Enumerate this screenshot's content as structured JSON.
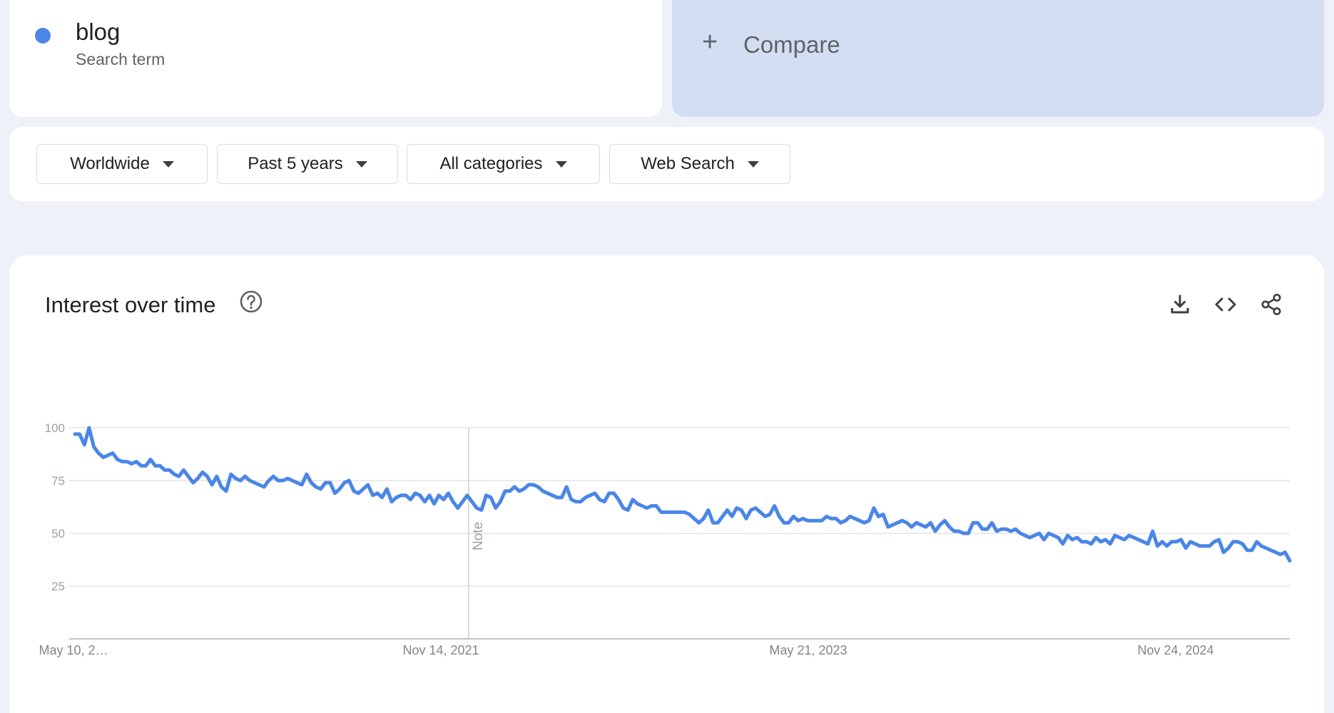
{
  "term": {
    "name": "blog",
    "type_label": "Search term",
    "color": "#4a86e8"
  },
  "compare": {
    "label": "Compare",
    "plus_glyph": "+"
  },
  "filters": [
    {
      "label": "Worldwide"
    },
    {
      "label": "Past 5 years"
    },
    {
      "label": "All categories"
    },
    {
      "label": "Web Search"
    }
  ],
  "chart_section": {
    "title": "Interest over time",
    "help_icon": "help-circle-icon",
    "toolbar_icons": [
      "download-icon",
      "embed-code-icon",
      "share-icon"
    ]
  },
  "chart_data": {
    "type": "line",
    "title": "Interest over time",
    "x_labels": [
      "May 10, 2…",
      "Nov 14, 2021",
      "May 21, 2023",
      "Nov 24, 2024"
    ],
    "y_ticks": [
      25,
      50,
      75,
      100
    ],
    "ylim": [
      0,
      100
    ],
    "grid": true,
    "annotation": {
      "label": "Note",
      "x_label": "Nov 14, 2021"
    },
    "series": [
      {
        "color": "#4a86e8",
        "values": [
          97,
          97,
          92,
          100,
          91,
          88,
          86,
          87,
          88,
          85,
          84,
          84,
          83,
          84,
          82,
          82,
          85,
          82,
          82,
          80,
          80,
          78,
          77,
          80,
          77,
          74,
          76,
          79,
          77,
          73,
          77,
          72,
          70,
          78,
          76,
          75,
          77,
          75,
          74,
          73,
          72,
          75,
          77,
          75,
          75,
          76,
          75,
          74,
          73,
          78,
          74,
          72,
          71,
          74,
          74,
          69,
          71,
          74,
          75,
          70,
          69,
          71,
          73,
          68,
          69,
          67,
          71,
          65,
          67,
          68,
          68,
          66,
          69,
          68,
          65,
          68,
          64,
          68,
          66,
          69,
          65,
          62,
          65,
          68,
          65,
          62,
          61,
          68,
          67,
          62,
          65,
          70,
          70,
          72,
          70,
          71,
          73,
          73,
          72,
          70,
          69,
          68,
          67,
          67,
          72,
          66,
          65,
          65,
          67,
          68,
          69,
          66,
          65,
          69,
          69,
          66,
          62,
          61,
          66,
          64,
          63,
          62,
          63,
          63,
          60,
          60,
          60,
          60,
          60,
          60,
          59,
          57,
          55,
          57,
          61,
          55,
          55,
          58,
          61,
          58,
          62,
          61,
          57,
          61,
          62,
          60,
          58,
          59,
          63,
          58,
          55,
          55,
          58,
          56,
          57,
          56,
          56,
          56,
          56,
          58,
          57,
          57,
          55,
          56,
          58,
          57,
          56,
          55,
          56,
          62,
          58,
          59,
          53,
          54,
          55,
          56,
          55,
          53,
          55,
          54,
          53,
          55,
          51,
          54,
          56,
          53,
          51,
          51,
          50,
          50,
          55,
          55,
          52,
          52,
          55,
          51,
          52,
          52,
          51,
          52,
          50,
          49,
          48,
          49,
          50,
          47,
          50,
          49,
          48,
          45,
          49,
          47,
          48,
          46,
          46,
          45,
          48,
          46,
          47,
          45,
          49,
          48,
          47,
          49,
          48,
          47,
          46,
          45,
          51,
          44,
          46,
          44,
          46,
          46,
          47,
          43,
          46,
          45,
          44,
          44,
          44,
          46,
          47,
          41,
          43,
          46,
          46,
          45,
          42,
          42,
          46,
          44,
          43,
          42,
          41,
          40,
          41,
          37
        ]
      }
    ]
  }
}
